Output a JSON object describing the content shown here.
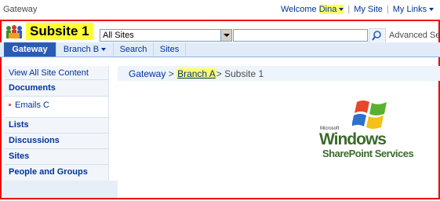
{
  "topbar": {
    "site_name": "Gateway",
    "welcome_prefix": "Welcome ",
    "user_name": "Dina",
    "my_site": "My Site",
    "my_links": "My Links"
  },
  "header": {
    "site_title": "Subsite 1",
    "search_scope": "All Sites",
    "search_value": "",
    "advanced_search": "Advanced Se"
  },
  "tabs": [
    {
      "label": "Gateway"
    },
    {
      "label": "Branch B"
    },
    {
      "label": "Search"
    },
    {
      "label": "Sites"
    }
  ],
  "leftnav": {
    "view_all": "View All Site Content",
    "documents": "Documents",
    "emails": "Emails C",
    "lists": "Lists",
    "discussions": "Discussions",
    "sites": "Sites",
    "people": "People and Groups"
  },
  "breadcrumb": {
    "root": "Gateway",
    "sep": ">",
    "branch": "Branch A",
    "current": "Subsite 1"
  },
  "brand": {
    "microsoft": "Microsoft",
    "windows": "Windows",
    "product": "SharePoint Services"
  },
  "colors": {
    "accent": "#2a5cb5",
    "highlight": "#ffff33",
    "link": "#003399",
    "frame": "#e00000"
  }
}
